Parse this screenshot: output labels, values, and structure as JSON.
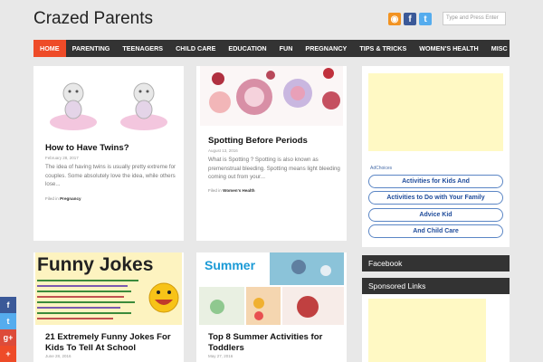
{
  "header": {
    "site_title": "Crazed Parents",
    "search_placeholder": "Type and Press Enter",
    "icons": [
      "rss-icon",
      "facebook-icon",
      "twitter-icon"
    ]
  },
  "nav": {
    "items": [
      "HOME",
      "PARENTING",
      "TEENAGERS",
      "CHILD CARE",
      "EDUCATION",
      "FUN",
      "PREGNANCY",
      "TIPS & TRICKS",
      "WOMEN'S HEALTH",
      "MISC"
    ],
    "active_color": "#ee4b28",
    "bar_color": "#333333"
  },
  "posts": [
    {
      "title": "How to Have Twins?",
      "date": "February 28, 2017",
      "excerpt": "The idea of having twins is usually pretty extreme for couples. Some absolutely love the idea, while others lose...",
      "filed_label": "Filed in",
      "category": "Pregnancy"
    },
    {
      "title": "Spotting Before Periods",
      "date": "August 13, 2016",
      "excerpt": "What is Spotting ? Spotting is also known as premenstrual bleeding. Spotting means light bleeding coming out from your...",
      "filed_label": "Filed in",
      "category": "Women's Health"
    },
    {
      "title": "21 Extremely Funny Jokes For Kids To Tell At School",
      "date": "June 28, 2016",
      "image_text": "Funny Jokes"
    },
    {
      "title": "Top 8 Summer Activities for Toddlers",
      "date": "May 27, 2016",
      "image_text": "Summer"
    }
  ],
  "sidebar": {
    "ad_choices": "AdChoices",
    "ad_links": [
      "Activities for Kids And",
      "Activities to Do with Your Family",
      "Advice Kid",
      "And Child Care"
    ],
    "widgets": [
      "Facebook",
      "Sponsored Links"
    ],
    "ad_color": "#fff9c4"
  },
  "share": {
    "buttons": [
      {
        "icon": "facebook-icon",
        "glyph": "f",
        "color": "#3b5998"
      },
      {
        "icon": "twitter-icon",
        "glyph": "t",
        "color": "#55acee"
      },
      {
        "icon": "google-plus-icon",
        "glyph": "g+",
        "color": "#dd4b39"
      },
      {
        "icon": "share-icon",
        "glyph": "+",
        "color": "#ee4b28"
      }
    ]
  }
}
